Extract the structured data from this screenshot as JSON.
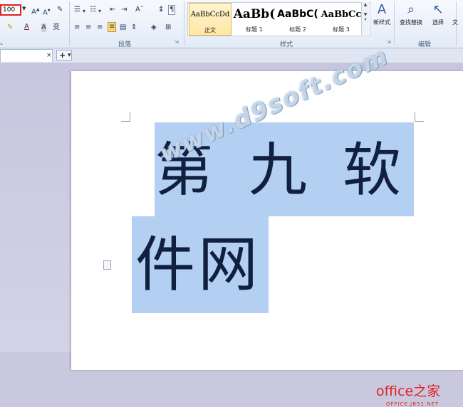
{
  "ribbon": {
    "font_size_value": "100",
    "groups": {
      "paragraph_label": "段落",
      "styles_label": "样式",
      "editing_label": "编辑"
    },
    "styles": [
      {
        "sample": "AaBbCcDd",
        "name": "正文",
        "selected": true
      },
      {
        "sample": "AaBb(",
        "name": "标题 1",
        "selected": false
      },
      {
        "sample": "AaBbC(",
        "name": "标题 2",
        "selected": false
      },
      {
        "sample": "AaBbCc",
        "name": "标题 3",
        "selected": false
      }
    ],
    "buttons": {
      "new_style": "新样式",
      "find_replace": "查找替换",
      "select": "选择",
      "text_partial": "文"
    }
  },
  "tabs": {
    "close_glyph": "×",
    "add_glyph": "+"
  },
  "document": {
    "line1": "第九软",
    "line2": "件网",
    "watermark": "www.d9soft.com"
  },
  "brand": {
    "name": "office之家",
    "sub": "OFFICE.JB51.NET"
  }
}
